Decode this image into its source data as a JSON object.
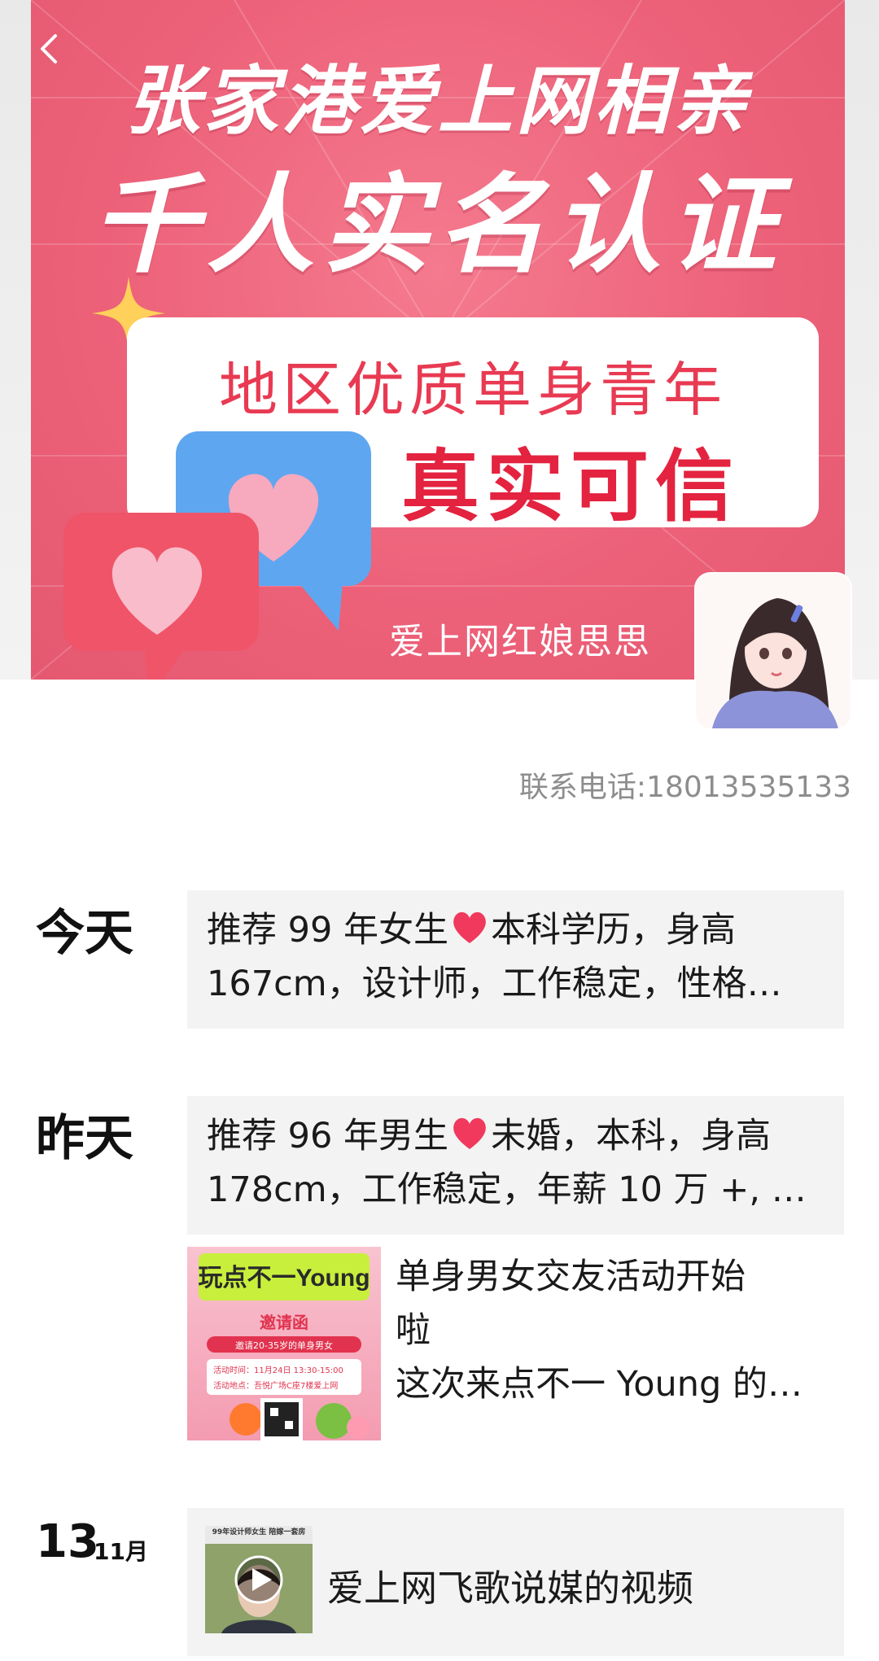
{
  "cover": {
    "title_line1": "张家港爱上网相亲",
    "title_line2": "千人实名认证",
    "card_line1": "地区优质单身青年",
    "card_line2": "真实可信",
    "credit": "爱上网红娘思思"
  },
  "icons": {
    "back": "chevron-left-icon",
    "heart": "heart-emoji-icon",
    "play": "play-icon"
  },
  "contact": {
    "text": "联系电话:18013535133"
  },
  "timeline": {
    "today": {
      "label": "今天",
      "post_line1_prefix": "推荐 99 年女生",
      "post_line1_suffix": "本科学历，身高",
      "post_line2": "167cm，设计师，工作稳定，性格…"
    },
    "yesterday": {
      "label": "昨天",
      "post_line1_prefix": "推荐 96 年男生",
      "post_line1_suffix": "未婚，本科，身高",
      "post_line2": "178cm，工作稳定，年薪 10 万 +, …",
      "event": {
        "thumb_title": "玩点不一Young",
        "thumb_invite": "邀请函",
        "thumb_sub": "邀请20-35岁的单身男女",
        "thumb_time": "活动时间：11月24日 13:30-15:00",
        "thumb_place": "活动地点：吾悦广场C座7楼爱上网",
        "line1": "单身男女交友活动开始",
        "line2": "啦",
        "line3": "这次来点不一 Young 的…"
      }
    },
    "nov13": {
      "day": "13",
      "month": "11月",
      "video_caption": "99年设计师女生 陪嫁一套房",
      "video_title": "爱上网飞歌说媒的视频"
    }
  },
  "colors": {
    "cover_bg": "#ec6078",
    "card_text": "#e3233f",
    "post_bg": "#f3f3f3",
    "contact_text": "#8d8d8d"
  }
}
